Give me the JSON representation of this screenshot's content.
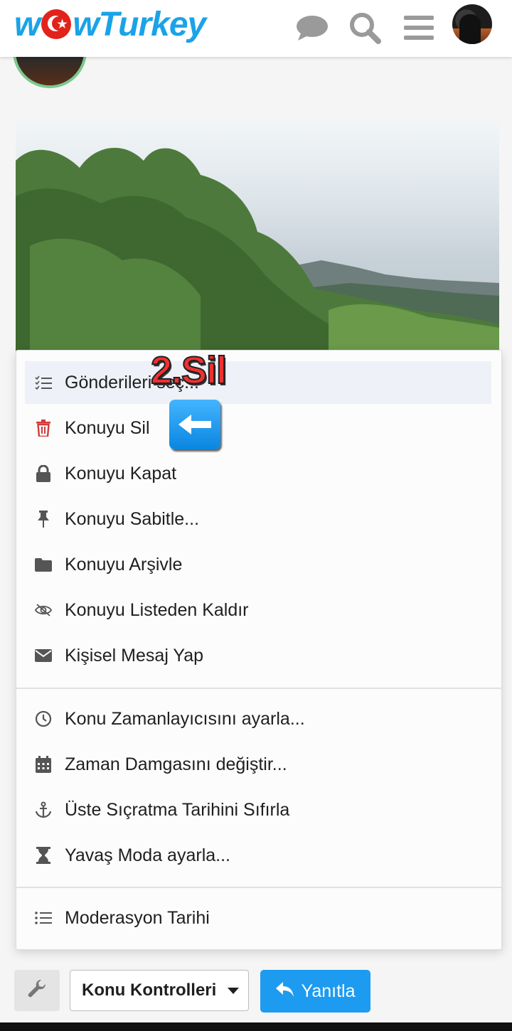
{
  "header": {
    "logo_text_1": "w",
    "logo_text_2": "wTurkey",
    "icons": [
      "chat-icon",
      "search-icon",
      "menu-icon",
      "user-avatar"
    ]
  },
  "menu": {
    "items": [
      {
        "label": "Gönderileri seç...",
        "icon": "select-list-icon"
      },
      {
        "label": "Konuyu Sil",
        "icon": "trash-icon"
      },
      {
        "label": "Konuyu Kapat",
        "icon": "lock-icon"
      },
      {
        "label": "Konuyu Sabitle...",
        "icon": "pin-icon"
      },
      {
        "label": "Konuyu Arşivle",
        "icon": "folder-icon"
      },
      {
        "label": "Konuyu Listeden Kaldır",
        "icon": "eye-slash-icon"
      },
      {
        "label": "Kişisel Mesaj Yap",
        "icon": "envelope-icon"
      },
      {
        "label": "Konu Zamanlayıcısını ayarla...",
        "icon": "clock-icon"
      },
      {
        "label": "Zaman Damgasını değiştir...",
        "icon": "calendar-icon"
      },
      {
        "label": "Üste Sıçratma Tarihini Sıfırla",
        "icon": "anchor-icon"
      },
      {
        "label": "Yavaş Moda ayarla...",
        "icon": "hourglass-icon"
      },
      {
        "label": "Moderasyon Tarihi",
        "icon": "list-icon"
      }
    ]
  },
  "annotation": {
    "text": "2.Sil"
  },
  "controls": {
    "thread_tools": "Konu Kontrolleri",
    "reply": "Yanıtla"
  },
  "colors": {
    "brand": "#1aa3e8",
    "reply_button": "#1d9bf0",
    "delete_icon": "#d23b3b",
    "annotation_text": "#f03030"
  }
}
